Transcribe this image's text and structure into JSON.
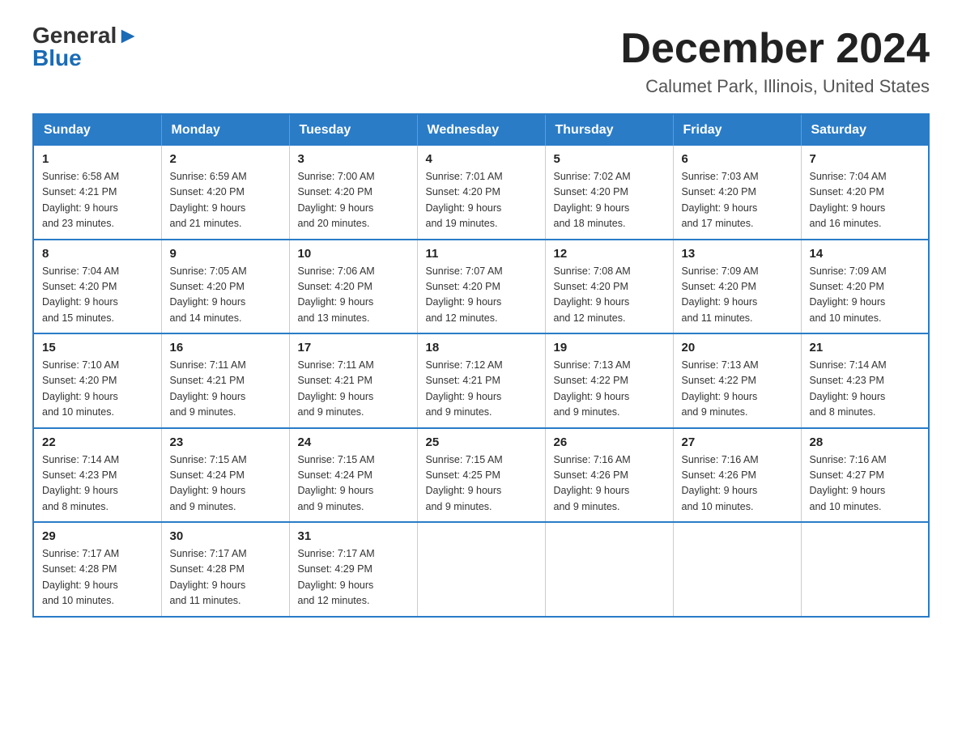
{
  "logo": {
    "general": "General",
    "blue_arrow": "▶",
    "blue": "Blue"
  },
  "title": "December 2024",
  "location": "Calumet Park, Illinois, United States",
  "weekdays": [
    "Sunday",
    "Monday",
    "Tuesday",
    "Wednesday",
    "Thursday",
    "Friday",
    "Saturday"
  ],
  "weeks": [
    [
      {
        "day": "1",
        "sunrise": "Sunrise: 6:58 AM",
        "sunset": "Sunset: 4:21 PM",
        "daylight": "Daylight: 9 hours",
        "daylight2": "and 23 minutes."
      },
      {
        "day": "2",
        "sunrise": "Sunrise: 6:59 AM",
        "sunset": "Sunset: 4:20 PM",
        "daylight": "Daylight: 9 hours",
        "daylight2": "and 21 minutes."
      },
      {
        "day": "3",
        "sunrise": "Sunrise: 7:00 AM",
        "sunset": "Sunset: 4:20 PM",
        "daylight": "Daylight: 9 hours",
        "daylight2": "and 20 minutes."
      },
      {
        "day": "4",
        "sunrise": "Sunrise: 7:01 AM",
        "sunset": "Sunset: 4:20 PM",
        "daylight": "Daylight: 9 hours",
        "daylight2": "and 19 minutes."
      },
      {
        "day": "5",
        "sunrise": "Sunrise: 7:02 AM",
        "sunset": "Sunset: 4:20 PM",
        "daylight": "Daylight: 9 hours",
        "daylight2": "and 18 minutes."
      },
      {
        "day": "6",
        "sunrise": "Sunrise: 7:03 AM",
        "sunset": "Sunset: 4:20 PM",
        "daylight": "Daylight: 9 hours",
        "daylight2": "and 17 minutes."
      },
      {
        "day": "7",
        "sunrise": "Sunrise: 7:04 AM",
        "sunset": "Sunset: 4:20 PM",
        "daylight": "Daylight: 9 hours",
        "daylight2": "and 16 minutes."
      }
    ],
    [
      {
        "day": "8",
        "sunrise": "Sunrise: 7:04 AM",
        "sunset": "Sunset: 4:20 PM",
        "daylight": "Daylight: 9 hours",
        "daylight2": "and 15 minutes."
      },
      {
        "day": "9",
        "sunrise": "Sunrise: 7:05 AM",
        "sunset": "Sunset: 4:20 PM",
        "daylight": "Daylight: 9 hours",
        "daylight2": "and 14 minutes."
      },
      {
        "day": "10",
        "sunrise": "Sunrise: 7:06 AM",
        "sunset": "Sunset: 4:20 PM",
        "daylight": "Daylight: 9 hours",
        "daylight2": "and 13 minutes."
      },
      {
        "day": "11",
        "sunrise": "Sunrise: 7:07 AM",
        "sunset": "Sunset: 4:20 PM",
        "daylight": "Daylight: 9 hours",
        "daylight2": "and 12 minutes."
      },
      {
        "day": "12",
        "sunrise": "Sunrise: 7:08 AM",
        "sunset": "Sunset: 4:20 PM",
        "daylight": "Daylight: 9 hours",
        "daylight2": "and 12 minutes."
      },
      {
        "day": "13",
        "sunrise": "Sunrise: 7:09 AM",
        "sunset": "Sunset: 4:20 PM",
        "daylight": "Daylight: 9 hours",
        "daylight2": "and 11 minutes."
      },
      {
        "day": "14",
        "sunrise": "Sunrise: 7:09 AM",
        "sunset": "Sunset: 4:20 PM",
        "daylight": "Daylight: 9 hours",
        "daylight2": "and 10 minutes."
      }
    ],
    [
      {
        "day": "15",
        "sunrise": "Sunrise: 7:10 AM",
        "sunset": "Sunset: 4:20 PM",
        "daylight": "Daylight: 9 hours",
        "daylight2": "and 10 minutes."
      },
      {
        "day": "16",
        "sunrise": "Sunrise: 7:11 AM",
        "sunset": "Sunset: 4:21 PM",
        "daylight": "Daylight: 9 hours",
        "daylight2": "and 9 minutes."
      },
      {
        "day": "17",
        "sunrise": "Sunrise: 7:11 AM",
        "sunset": "Sunset: 4:21 PM",
        "daylight": "Daylight: 9 hours",
        "daylight2": "and 9 minutes."
      },
      {
        "day": "18",
        "sunrise": "Sunrise: 7:12 AM",
        "sunset": "Sunset: 4:21 PM",
        "daylight": "Daylight: 9 hours",
        "daylight2": "and 9 minutes."
      },
      {
        "day": "19",
        "sunrise": "Sunrise: 7:13 AM",
        "sunset": "Sunset: 4:22 PM",
        "daylight": "Daylight: 9 hours",
        "daylight2": "and 9 minutes."
      },
      {
        "day": "20",
        "sunrise": "Sunrise: 7:13 AM",
        "sunset": "Sunset: 4:22 PM",
        "daylight": "Daylight: 9 hours",
        "daylight2": "and 9 minutes."
      },
      {
        "day": "21",
        "sunrise": "Sunrise: 7:14 AM",
        "sunset": "Sunset: 4:23 PM",
        "daylight": "Daylight: 9 hours",
        "daylight2": "and 8 minutes."
      }
    ],
    [
      {
        "day": "22",
        "sunrise": "Sunrise: 7:14 AM",
        "sunset": "Sunset: 4:23 PM",
        "daylight": "Daylight: 9 hours",
        "daylight2": "and 8 minutes."
      },
      {
        "day": "23",
        "sunrise": "Sunrise: 7:15 AM",
        "sunset": "Sunset: 4:24 PM",
        "daylight": "Daylight: 9 hours",
        "daylight2": "and 9 minutes."
      },
      {
        "day": "24",
        "sunrise": "Sunrise: 7:15 AM",
        "sunset": "Sunset: 4:24 PM",
        "daylight": "Daylight: 9 hours",
        "daylight2": "and 9 minutes."
      },
      {
        "day": "25",
        "sunrise": "Sunrise: 7:15 AM",
        "sunset": "Sunset: 4:25 PM",
        "daylight": "Daylight: 9 hours",
        "daylight2": "and 9 minutes."
      },
      {
        "day": "26",
        "sunrise": "Sunrise: 7:16 AM",
        "sunset": "Sunset: 4:26 PM",
        "daylight": "Daylight: 9 hours",
        "daylight2": "and 9 minutes."
      },
      {
        "day": "27",
        "sunrise": "Sunrise: 7:16 AM",
        "sunset": "Sunset: 4:26 PM",
        "daylight": "Daylight: 9 hours",
        "daylight2": "and 10 minutes."
      },
      {
        "day": "28",
        "sunrise": "Sunrise: 7:16 AM",
        "sunset": "Sunset: 4:27 PM",
        "daylight": "Daylight: 9 hours",
        "daylight2": "and 10 minutes."
      }
    ],
    [
      {
        "day": "29",
        "sunrise": "Sunrise: 7:17 AM",
        "sunset": "Sunset: 4:28 PM",
        "daylight": "Daylight: 9 hours",
        "daylight2": "and 10 minutes."
      },
      {
        "day": "30",
        "sunrise": "Sunrise: 7:17 AM",
        "sunset": "Sunset: 4:28 PM",
        "daylight": "Daylight: 9 hours",
        "daylight2": "and 11 minutes."
      },
      {
        "day": "31",
        "sunrise": "Sunrise: 7:17 AM",
        "sunset": "Sunset: 4:29 PM",
        "daylight": "Daylight: 9 hours",
        "daylight2": "and 12 minutes."
      },
      null,
      null,
      null,
      null
    ]
  ]
}
